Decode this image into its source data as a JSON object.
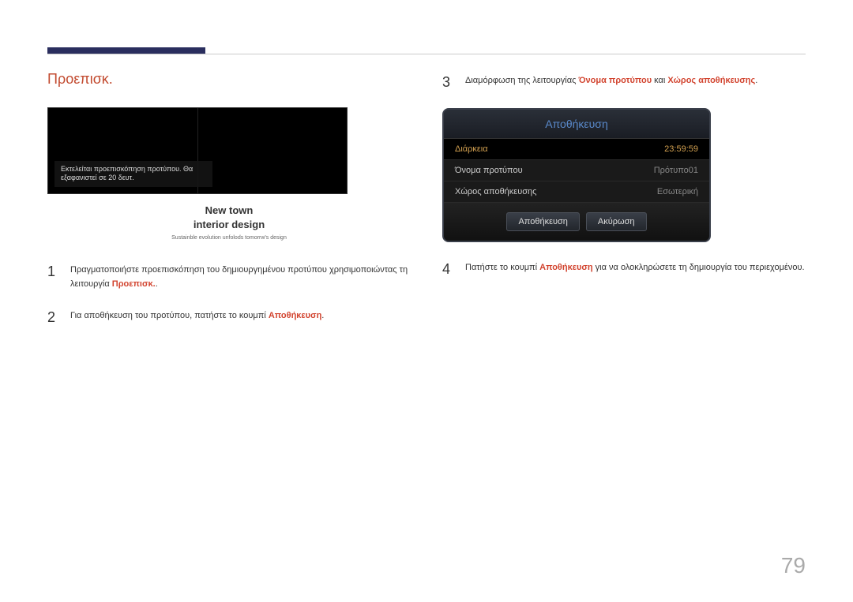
{
  "page_number": "79",
  "left": {
    "title": "Προεπισκ.",
    "preview_caption": "Εκτελείται προεπισκόπηση προτύπου. Θα εξαφανιστεί σε 20 δευτ.",
    "caption_line1": "New town",
    "caption_line2": "interior design",
    "caption_sub": "Sustainble evolution unfolods tomorrw's design",
    "steps": [
      {
        "num": "1",
        "pre": "Πραγματοποιήστε προεπισκόπηση του δημιουργημένου προτύπου χρησιμοποιώντας τη λειτουργία ",
        "kw": "Προεπισκ.",
        "post": "."
      },
      {
        "num": "2",
        "pre": "Για αποθήκευση του προτύπου, πατήστε το κουμπί ",
        "kw": "Αποθήκευση",
        "post": "."
      }
    ]
  },
  "right": {
    "step3": {
      "num": "3",
      "pre": "Διαμόρφωση της λειτουργίας ",
      "kw1": "Όνομα προτύπου",
      "mid": " και ",
      "kw2": "Χώρος αποθήκευσης",
      "post": "."
    },
    "dialog": {
      "title": "Αποθήκευση",
      "rows": [
        {
          "label": "Διάρκεια",
          "value": "23:59:59",
          "selected": true
        },
        {
          "label": "Όνομα προτύπου",
          "value": "Πρότυπο01",
          "selected": false
        },
        {
          "label": "Χώρος αποθήκευσης",
          "value": "Εσωτερική",
          "selected": false
        }
      ],
      "save": "Αποθήκευση",
      "cancel": "Ακύρωση"
    },
    "step4": {
      "num": "4",
      "pre": "Πατήστε το κουμπί ",
      "kw": "Αποθήκευση",
      "post": " για να ολοκληρώσετε τη δημιουργία του περιεχομένου."
    }
  }
}
